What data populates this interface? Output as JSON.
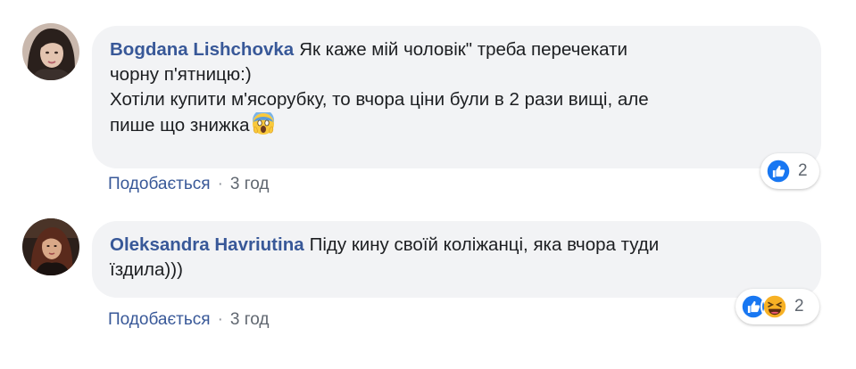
{
  "comments": [
    {
      "author": "Bogdana Lishchovka",
      "lines": [
        "Як каже мій чоловік\" треба перечекати",
        "чорну п'ятницю:)",
        "Хотіли купити м'ясорубку, то вчора ціни були в 2 рази вищі, але",
        "пише що знижка"
      ],
      "emoji": "face-screaming-icon",
      "reaction_count": "2",
      "like_label": "Подобається",
      "separator": "·",
      "time": "3 год"
    },
    {
      "author": "Oleksandra Havriutina",
      "lines": [
        "Піду кину своїй коліжанці, яка вчора туди",
        "їздила)))"
      ],
      "reaction_count": "2",
      "like_label": "Подобається",
      "separator": "·",
      "time": "3 год"
    }
  ],
  "colors": {
    "author": "#385898",
    "bubble": "#f2f3f5",
    "like_blue": "#1877f2",
    "haha_yellow": "#f7b125",
    "meta_gray": "#606770"
  }
}
